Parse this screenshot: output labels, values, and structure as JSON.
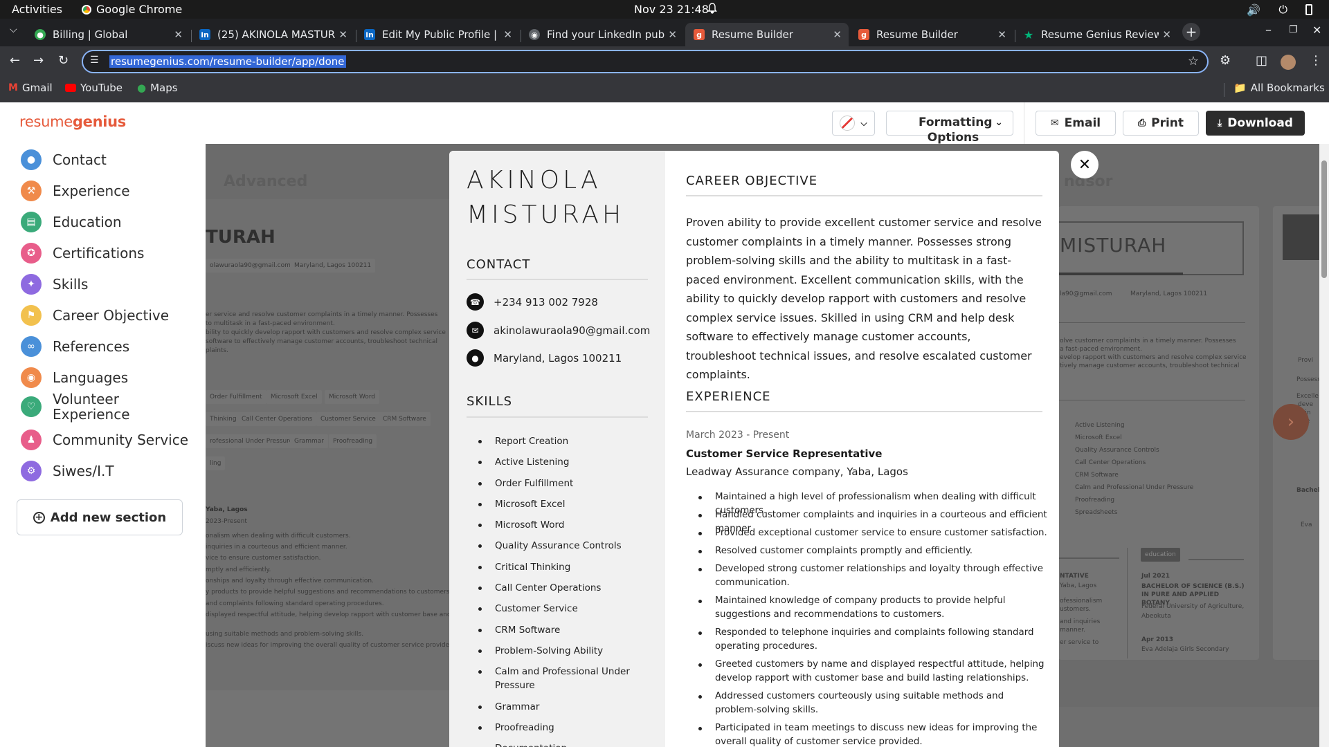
{
  "os": {
    "activities": "Activities",
    "app_name": "Google Chrome",
    "clock": "Nov 23  21:48"
  },
  "browser": {
    "tabs": [
      {
        "title": "Billing | Global",
        "icon": "globe-icon",
        "color": "#34a853"
      },
      {
        "title": "(25) AKINOLA MASTURA",
        "icon": "linkedin-icon",
        "color": "#0a66c2"
      },
      {
        "title": "Edit My Public Profile | L",
        "icon": "linkedin-icon",
        "color": "#0a66c2"
      },
      {
        "title": "Find your LinkedIn publi",
        "icon": "site-icon",
        "color": "#5f6368"
      },
      {
        "title": "Resume Builder",
        "icon": "resumegenius-icon",
        "color": "#e65a3b"
      },
      {
        "title": "Resume Builder",
        "icon": "resumegenius-icon",
        "color": "#e65a3b"
      },
      {
        "title": "Resume Genius Review",
        "icon": "star-icon",
        "color": "#00b67a"
      }
    ],
    "url": "resumegenius.com/resume-builder/app/done",
    "bookmarks": [
      "Gmail",
      "YouTube",
      "Maps"
    ],
    "all_bookmarks": "All Bookmarks"
  },
  "header": {
    "logo_part1": "resume",
    "logo_part2": "genius",
    "formatting": "Formatting Options",
    "email": "Email",
    "print": "Print",
    "download": "Download",
    "accent": "#e65a3b"
  },
  "sidebar": {
    "items": [
      {
        "label": "Contact",
        "icon": "user-icon",
        "color": "#4a90d9"
      },
      {
        "label": "Experience",
        "icon": "hammer-icon",
        "color": "#f08a4b"
      },
      {
        "label": "Education",
        "icon": "book-icon",
        "color": "#3aaa7a"
      },
      {
        "label": "Certifications",
        "icon": "badge-icon",
        "color": "#e85d8a"
      },
      {
        "label": "Skills",
        "icon": "wand-icon",
        "color": "#8e6ae0"
      },
      {
        "label": "Career Objective",
        "icon": "flag-icon",
        "color": "#f2c14e"
      },
      {
        "label": "References",
        "icon": "link-icon",
        "color": "#4a90d9"
      },
      {
        "label": "Languages",
        "icon": "globe-icon",
        "color": "#f08a4b"
      },
      {
        "label": "Volunteer Experience",
        "icon": "heart-icon",
        "color": "#3aaa7a"
      },
      {
        "label": "Community Service",
        "icon": "people-icon",
        "color": "#e85d8a"
      },
      {
        "label": "Siwes/I.T",
        "icon": "gear-icon",
        "color": "#8e6ae0"
      }
    ],
    "add_section": "Add new section"
  },
  "background": {
    "left_tab": "Advanced",
    "right_tab": "ndsor",
    "left_name": "TURAH",
    "right_name": "MISTURAH",
    "left_email": "olawuraola90@gmail.com",
    "left_loc": "Maryland, Lagos 100211",
    "right_email": "la90@gmail.com",
    "right_loc": "Maryland, Lagos 100211",
    "left_lines": [
      "er service and resolve customer complaints in a timely manner. Possesses",
      "to multitask in a fast-paced environment.",
      "bility to quickly develop rapport with customers and resolve complex service",
      "software to effectively manage customer accounts, troubleshoot technical",
      "plaints."
    ],
    "left_chips": [
      "Order Fulfillment",
      "Microsoft Excel",
      "Microsoft Word",
      "Thinking",
      "Call Center Operations",
      "Customer Service",
      "CRM Software",
      "rofessional Under Pressure",
      "Grammar",
      "Proofreading",
      "ling"
    ],
    "left_job": "Yaba, Lagos",
    "left_job_date": "2023-Present",
    "left_bullets": [
      "onalism when dealing with difficult customers.",
      "inquiries in a courteous and efficient manner.",
      "vice to ensure customer satisfaction.",
      "mptly and efficiently.",
      "onships and loyalty through effective communication.",
      "y products to provide helpful suggestions and recommendations to customers.",
      "and complaints following standard operating procedures.",
      "displayed respectful attitude, helping develop rapport with customer base and",
      "using suitable methods and problem-solving skills.",
      "iscuss new ideas for improving the overall quality of customer service provided."
    ],
    "right_lines": [
      "olve customer complaints in a timely manner. Possesses",
      "a fast-paced environment.",
      "evelop rapport with customers and resolve complex service",
      "tively manage customer accounts, troubleshoot technical"
    ],
    "right_skills": [
      "Active Listening",
      "Microsoft Excel",
      "Quality Assurance Controls",
      "Call Center Operations",
      "CRM Software",
      "Calm and Professional Under Pressure",
      "Proofreading",
      "Spreadsheets"
    ],
    "right_edge_words": [
      "Provi",
      "Possess",
      "Excelle",
      "deve",
      "usin",
      "effe",
      "Bachel",
      "Eva"
    ],
    "right_edu_tag": "education",
    "right_edu_date1": "Jul 2021",
    "right_edu_degree": "BACHELOR OF SCIENCE (B.S.) IN PURE AND APPLIED BOTANY",
    "right_edu_school": "Federal University of Agriculture, Abeokuta",
    "right_edu_date2": "Apr 2013",
    "right_edu_school2": "Eva Adelaja Girls Secondary",
    "right_job_lines": [
      "NTATIVE",
      "Yaba, Lagos",
      "ofessionalism",
      "ustomers.",
      "and inquiries",
      "manner.",
      "er service to"
    ]
  },
  "resume": {
    "first_name": "AKINOLA",
    "last_name": "MISTURAH",
    "contact_head": "CONTACT",
    "phone": "+234 913 002 7928",
    "email": "akinolawuraola90@gmail.com",
    "location": "Maryland, Lagos 100211",
    "skills_head": "SKILLS",
    "skills": [
      "Report Creation",
      "Active Listening",
      "Order Fulfillment",
      "Microsoft Excel",
      "Microsoft Word",
      "Quality Assurance Controls",
      "Critical Thinking",
      "Call Center Operations",
      "Customer Service",
      "CRM Software",
      "Problem-Solving Ability",
      "Calm and Professional Under Pressure",
      "Grammar",
      "Proofreading",
      "Documentation"
    ],
    "objective_head": "CAREER OBJECTIVE",
    "objective": "Proven ability to provide excellent customer service and resolve customer complaints in a timely manner. Possesses strong problem-solving skills and the ability to multitask in a fast-paced environment. Excellent communication skills, with the ability to quickly develop rapport with customers and resolve complex service issues. Skilled in using CRM and help desk software to effectively manage customer accounts, troubleshoot technical issues, and resolve escalated customer complaints.",
    "experience_head": "EXPERIENCE",
    "job_date": "March 2023 - Present",
    "job_title": "Customer Service Representative",
    "job_company": "Leadway Assurance company, Yaba, Lagos",
    "job_bullets": [
      "Maintained a high level of professionalism when dealing with difficult customers.",
      "Handled customer complaints and inquiries in a courteous and efficient manner.",
      "Provided exceptional customer service to ensure customer satisfaction.",
      "Resolved customer complaints promptly and efficiently.",
      "Developed strong customer relationships and loyalty through effective communication.",
      "Maintained knowledge of company products to provide helpful suggestions and recommendations to customers.",
      "Responded to telephone inquiries and complaints following standard operating procedures.",
      "Greeted customers by name and displayed respectful attitude, helping develop rapport with customer base and build lasting relationships.",
      "Addressed customers courteously using suitable methods and problem-solving skills.",
      "Participated in team meetings to discuss new ideas for improving the overall quality of customer service provided."
    ]
  }
}
